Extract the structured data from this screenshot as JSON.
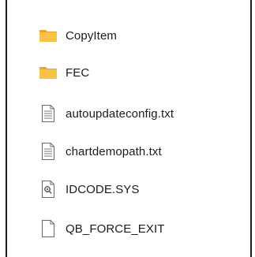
{
  "items": [
    {
      "label": "CopyItem",
      "icon": "folder-icon"
    },
    {
      "label": "FEC",
      "icon": "folder-icon"
    },
    {
      "label": "autoupdateconfig.txt",
      "icon": "text-file-icon"
    },
    {
      "label": "chartdemopath.txt",
      "icon": "text-file-icon"
    },
    {
      "label": "IDCODE.SYS",
      "icon": "system-file-icon"
    },
    {
      "label": "QB_FORCE_EXIT",
      "icon": "blank-file-icon"
    }
  ],
  "colors": {
    "folder": "#F6C348",
    "folder_dark": "#E9A72A",
    "border": "#1a1a1a",
    "text": "#1b1b1b"
  }
}
